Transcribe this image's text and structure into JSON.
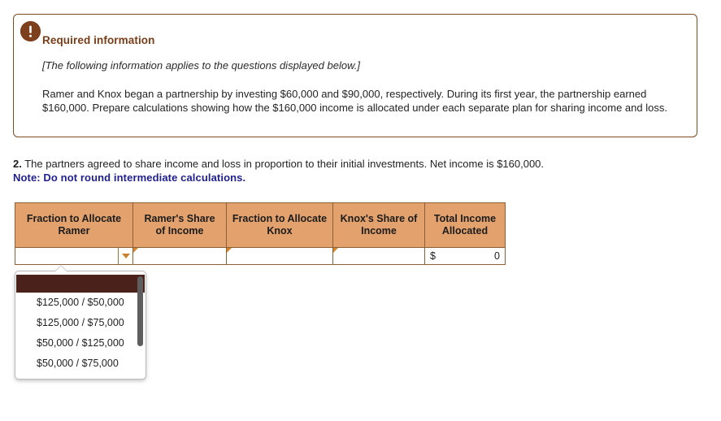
{
  "alert_panel": {
    "icon": "exclamation-circle-icon",
    "heading": "Required information",
    "applies_note": "[The following information applies to the questions displayed below.]",
    "body": "Ramer and Knox began a partnership by investing $60,000 and $90,000, respectively. During its first year, the partnership earned $160,000. Prepare calculations showing how the $160,000 income is allocated under each separate plan for sharing income and loss.",
    "border_color": "#7b4b22",
    "icon_color": "#7d3f1c",
    "heading_color": "#7a3c17"
  },
  "question": {
    "number": "2.",
    "text": "The partners agreed to share income and loss in proportion to their initial investments. Net income is $160,000.",
    "note": "Note: Do not round intermediate calculations.",
    "note_color": "#1f1f8f"
  },
  "table": {
    "header_bg": "#e2a16d",
    "border_color": "#8a6137",
    "columns": [
      "Fraction to Allocate Ramer",
      "Ramer's Share of Income",
      "Fraction to Allocate Knox",
      "Knox's Share of Income",
      "Total Income Allocated"
    ],
    "columns_split": [
      [
        "Fraction to Allocate",
        "Ramer"
      ],
      [
        "Ramer's Share",
        "of Income"
      ],
      [
        "Fraction to Allocate",
        "Knox"
      ],
      [
        "Knox's Share of",
        "Income"
      ],
      [
        "Total Income",
        "Allocated"
      ]
    ],
    "row": {
      "fraction_ramer_value": "",
      "fraction_ramer_placeholder": "",
      "ramer_share_value": "",
      "fraction_knox_value": "",
      "knox_share_value": "",
      "total_currency_symbol": "$",
      "total_value": "0"
    }
  },
  "dropdown": {
    "open": true,
    "selected_index": 0,
    "selected_label": "",
    "highlight_color": "#4a221b",
    "options": [
      "",
      "$125,000 / $50,000",
      "$125,000 / $75,000",
      "$50,000 / $125,000",
      "$50,000 / $75,000"
    ]
  }
}
